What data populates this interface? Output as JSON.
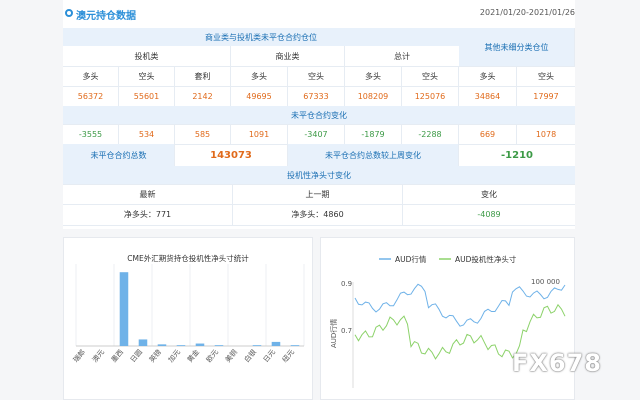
{
  "header": {
    "title": "澳元持仓数据",
    "date_range": "2021/01/20-2021/01/26"
  },
  "table": {
    "group_title": "商业类与投机类未平仓合约仓位",
    "other_title": "其他未细分类仓位",
    "groups": [
      "投机类",
      "商业类",
      "总计"
    ],
    "col_heads": [
      "多头",
      "空头",
      "套利",
      "多头",
      "空头",
      "多头",
      "空头",
      "多头",
      "空头"
    ],
    "values": [
      "56372",
      "55601",
      "2142",
      "49695",
      "67333",
      "108209",
      "125076",
      "34864",
      "17997"
    ],
    "change_title": "未平仓合约变化",
    "changes": [
      "-3555",
      "534",
      "585",
      "1091",
      "-3407",
      "-1879",
      "-2288",
      "669",
      "1078"
    ],
    "total_label": "未平仓合约总数",
    "total_value": "143073",
    "weekly_label": "未平仓合约总数较上周变化",
    "weekly_value": "-1210",
    "spec_title": "投机性净头寸变化",
    "spec_heads": [
      "最新",
      "上一期",
      "变化"
    ],
    "spec_latest": "净多头：771",
    "spec_previous": "净多头：4860",
    "spec_change": "-4089"
  },
  "chart_data": [
    {
      "type": "bar",
      "title": "CME外汇期货持仓投机性净头寸统计",
      "categories": [
        "瑞郎",
        "澳元",
        "墨西",
        "日圆",
        "英镑",
        "加元",
        "黄金",
        "欧元",
        "美铜",
        "白银",
        "日元",
        "纽元"
      ],
      "values": [
        0,
        0,
        9,
        0.8,
        0.2,
        0.1,
        0.3,
        0.1,
        0,
        0.1,
        0.5,
        0.1
      ],
      "colors": {
        "bar": "#6fb2e8"
      }
    },
    {
      "type": "line",
      "legend": [
        "AUD行情",
        "AUD投机性净头寸"
      ],
      "ylabel": "AUD行情",
      "left_ticks": [
        "0.9",
        "0.7"
      ],
      "right_ticks": [
        "100 000"
      ],
      "colors": {
        "aud": "#6fb2e8",
        "net": "#8cd26a"
      }
    }
  ],
  "watermark": "FX678"
}
